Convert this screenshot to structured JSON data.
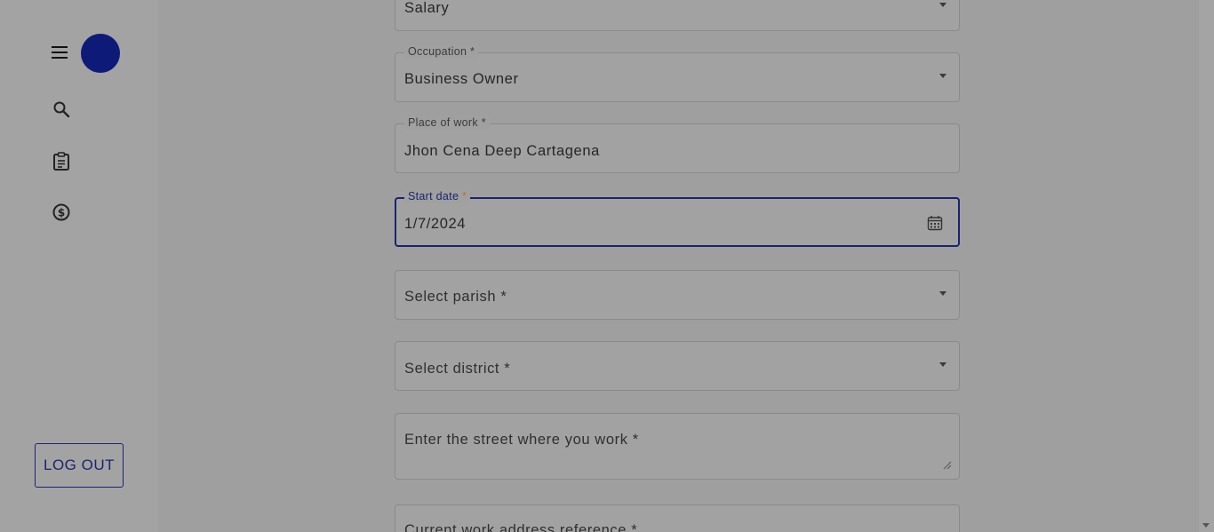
{
  "sidebar": {
    "menu_icon": "hamburger-menu-icon",
    "nav_items": [
      {
        "icon": "search-icon"
      },
      {
        "icon": "clipboard-icon"
      },
      {
        "icon": "dollar-circle-icon"
      }
    ],
    "logout_label": "LOG OUT"
  },
  "form": {
    "income_type": {
      "value": "Salary"
    },
    "occupation": {
      "label": "Occupation",
      "value": "Business Owner"
    },
    "place_of_work": {
      "label": "Place of work",
      "value": "Jhon Cena Deep Cartagena"
    },
    "start_date": {
      "label": "Start date",
      "value": "1/7/2024"
    },
    "parish": {
      "placeholder": "Select parish *"
    },
    "district": {
      "placeholder": "Select district *"
    },
    "street": {
      "placeholder": "Enter the street where you work *"
    },
    "address_reference": {
      "placeholder": "Current work address reference *"
    },
    "required_marker": "*"
  },
  "colors": {
    "accent": "#1a2370",
    "avatar": "#0e1a78",
    "overlay_background": "#9e9e9e"
  }
}
